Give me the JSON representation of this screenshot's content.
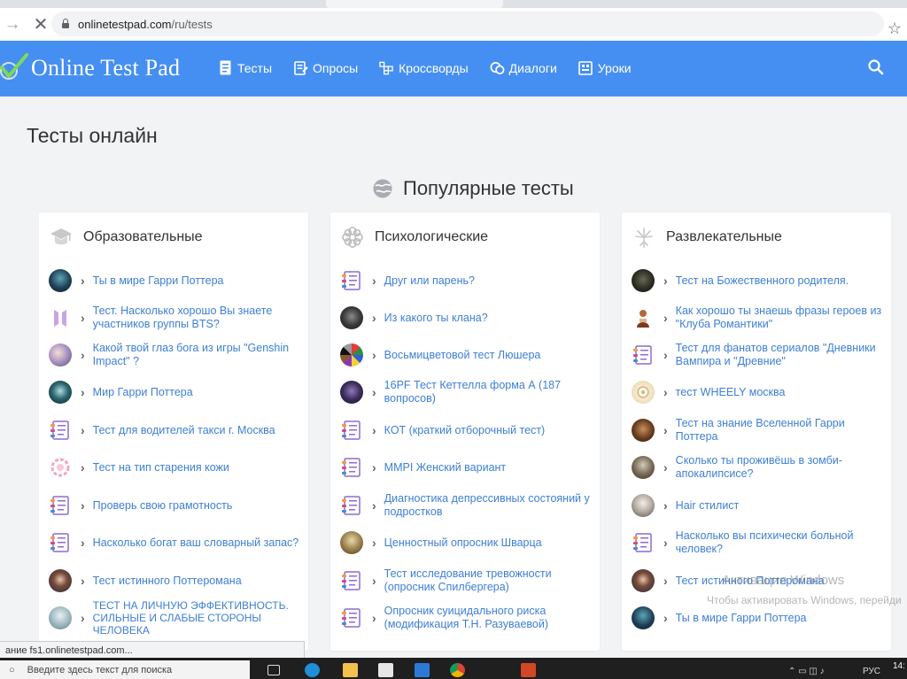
{
  "browser": {
    "url_host": "onlinetestpad.com",
    "url_path": "/ru/tests"
  },
  "site": {
    "logo": "Online Test Pad",
    "nav": [
      {
        "label": "Тесты",
        "icon": "document-icon"
      },
      {
        "label": "Опросы",
        "icon": "survey-icon"
      },
      {
        "label": "Кроссворды",
        "icon": "crossword-icon"
      },
      {
        "label": "Диалоги",
        "icon": "dialog-icon"
      },
      {
        "label": "Уроки",
        "icon": "lesson-icon"
      }
    ]
  },
  "page": {
    "title": "Тесты онлайн",
    "popular_title": "Популярные тесты"
  },
  "categories": [
    {
      "title": "Образовательные",
      "items": [
        "Ты в мире Гарри Поттера",
        "Тест. Насколько хорошо Вы знаете участников группы BTS?",
        "Какой твой глаз бога из игры \"Genshin Impact\" ?",
        "Мир Гарри Поттера",
        "Тест для водителей такси г. Москва",
        "Тест на тип старения кожи",
        "Проверь свою грамотность",
        "Насколько богат ваш словарный запас?",
        "Тест истинного Поттеромана",
        "ТЕСТ НА ЛИЧНУЮ ЭФФЕКТИВНОСТЬ. СИЛЬНЫЕ И СЛАБЫЕ СТОРОНЫ ЧЕЛОВЕКА"
      ]
    },
    {
      "title": "Психологические",
      "items": [
        "Друг или парень?",
        "Из какого ты клана?",
        "Восьмицветовой тест Люшера",
        "16PF Тест Кеттелла форма А (187 вопросов)",
        "КОТ (краткий отборочный тест)",
        "MMPI Женский вариант",
        "Диагностика депрессивных состояний у подростков",
        "Ценностный опросник Шварца",
        "Тест исследование тревожности (опросник Спилбергера)",
        "Опросник суицидального риска (модификация Т.Н. Разуваевой)"
      ]
    },
    {
      "title": "Развлекательные",
      "items": [
        "Тест на Божественного родителя.",
        "Как хорошо ты знаешь фразы героев из \"Клуба Романтики\"",
        "Тест для фанатов сериалов \"Дневники Вампира и \"Древние\"",
        "тест WHEELY москва",
        "Тест на знание Вселенной Гарри Поттера",
        "Сколько ты проживёшь в зомби-апокалипсисе?",
        "Hair стилист",
        "Насколько вы психически больной человек?",
        "Тест истинного Поттеромана",
        "Ты в мире Гарри Поттера"
      ]
    }
  ],
  "status": "ание fs1.onlinetestpad.com...",
  "watermark": {
    "line1": "Активация Windows",
    "line2": "Чтобы активировать Windows, перейди"
  },
  "taskbar": {
    "search_placeholder": "Введите здесь текст для поиска",
    "lang": "РУС",
    "time": "14:"
  },
  "colors": {
    "header": "#468ff2",
    "link": "#3d7fd6",
    "page_bg": "#f1f3f4"
  }
}
